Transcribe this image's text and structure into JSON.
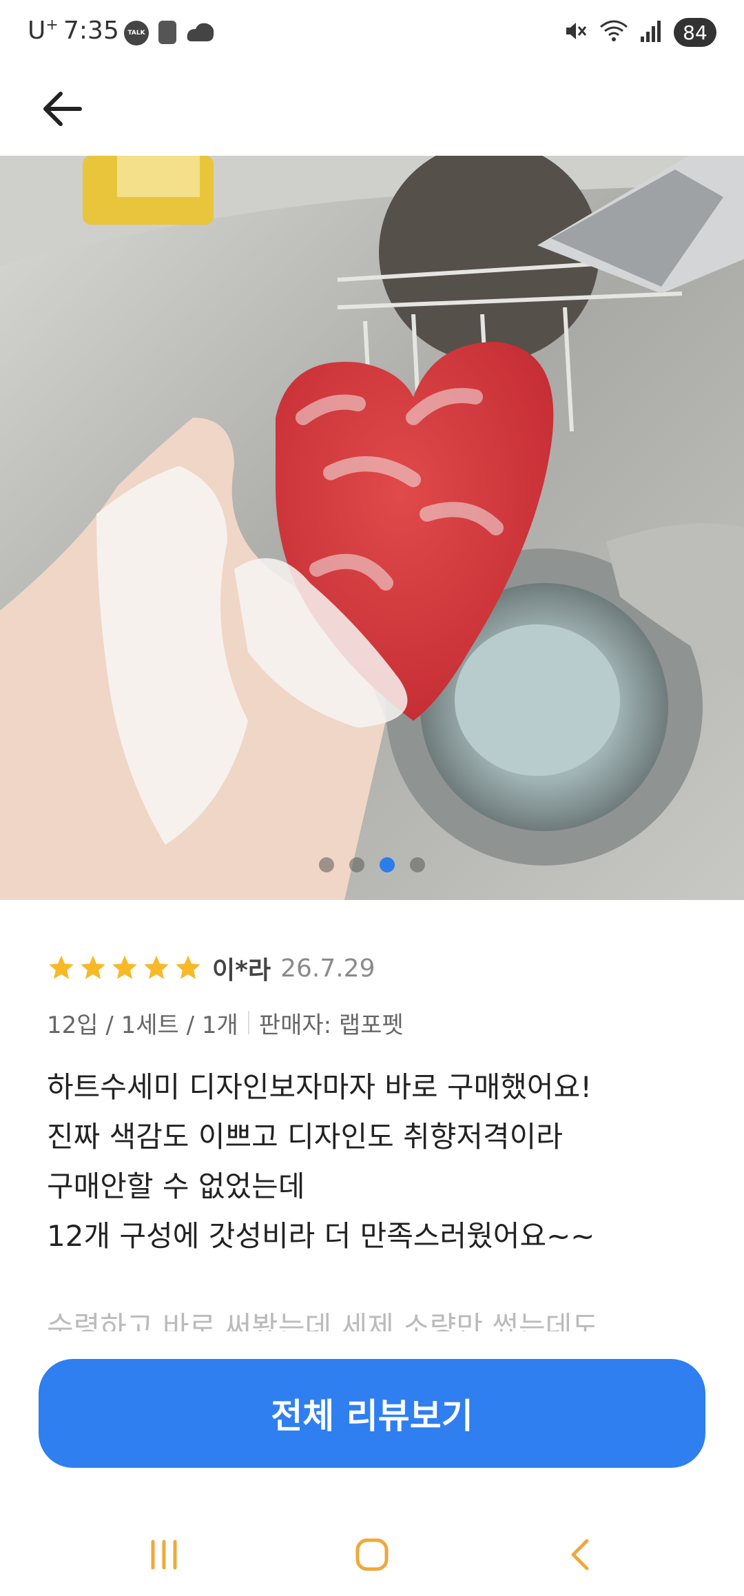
{
  "status_bar": {
    "carrier": "U",
    "time": "7:35",
    "battery": "84",
    "icons": [
      "talk-icon",
      "easy-icon",
      "cloud-icon",
      "mute-icon",
      "wifi-icon",
      "signal-icon"
    ]
  },
  "app_bar": {
    "back_icon": "arrow-left-icon"
  },
  "gallery": {
    "image_count": 4,
    "active_index": 2
  },
  "review": {
    "rating": 5,
    "reviewer": "이*라",
    "date": "26.7.29",
    "option": "12입 / 1세트 / 1개",
    "seller": "판매자: 랩포펫",
    "lines": [
      "하트수세미 디자인보자마자 바로 구매했어요!",
      "진짜 색감도 이쁘고 디자인도 취향저격이라",
      "구매안할 수 없었는데",
      "12개 구성에 갓성비라 더 만족스러웠어요~~"
    ],
    "faded_line": "수령하고 바로 써봤는데 세제 소량만 썼는데도"
  },
  "cta": {
    "label": "전체 리뷰보기"
  },
  "colors": {
    "accent": "#2f7ff0",
    "star": "#f7b928",
    "dot_active": "#2b7de9"
  },
  "nav_bar": {
    "icons": [
      "recents-icon",
      "home-icon",
      "back-icon"
    ]
  }
}
